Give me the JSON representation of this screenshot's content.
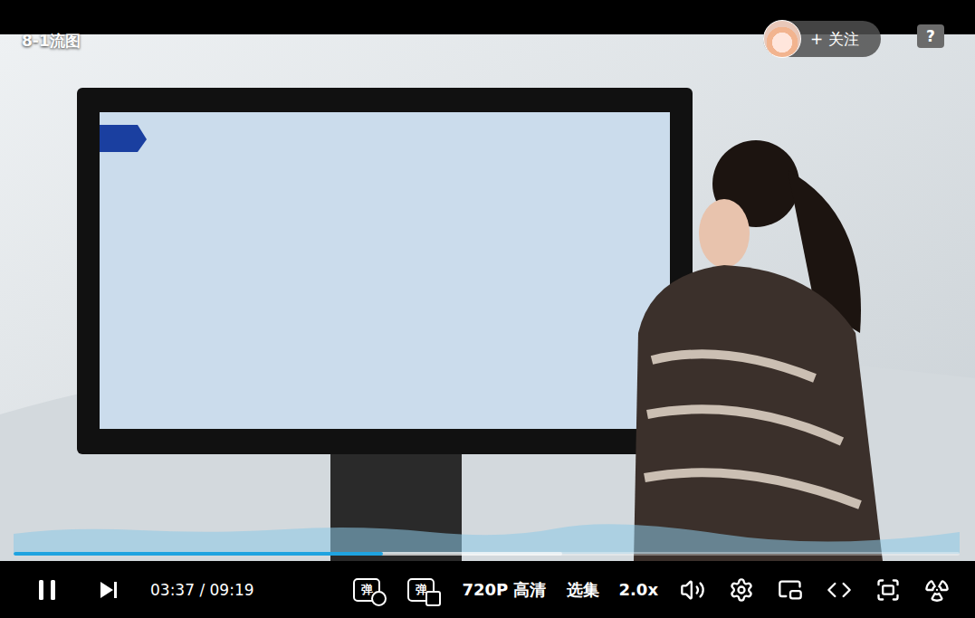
{
  "header": {
    "title": "8-1流图"
  },
  "uploader": {
    "follow_icon": "+",
    "follow_label": "关注",
    "help_icon": "?"
  },
  "progress": {
    "level": 0.39,
    "buffered": 0.58
  },
  "controls": {
    "playing": true,
    "time_current": "03:37",
    "time_separator": "/",
    "time_total": "09:19",
    "danmaku": [
      {
        "kind": "toggle",
        "label": "弹"
      },
      {
        "kind": "settings",
        "label": "弹"
      }
    ],
    "quality": "720P 高清",
    "episodes": "选集",
    "speed": "2.0x"
  }
}
